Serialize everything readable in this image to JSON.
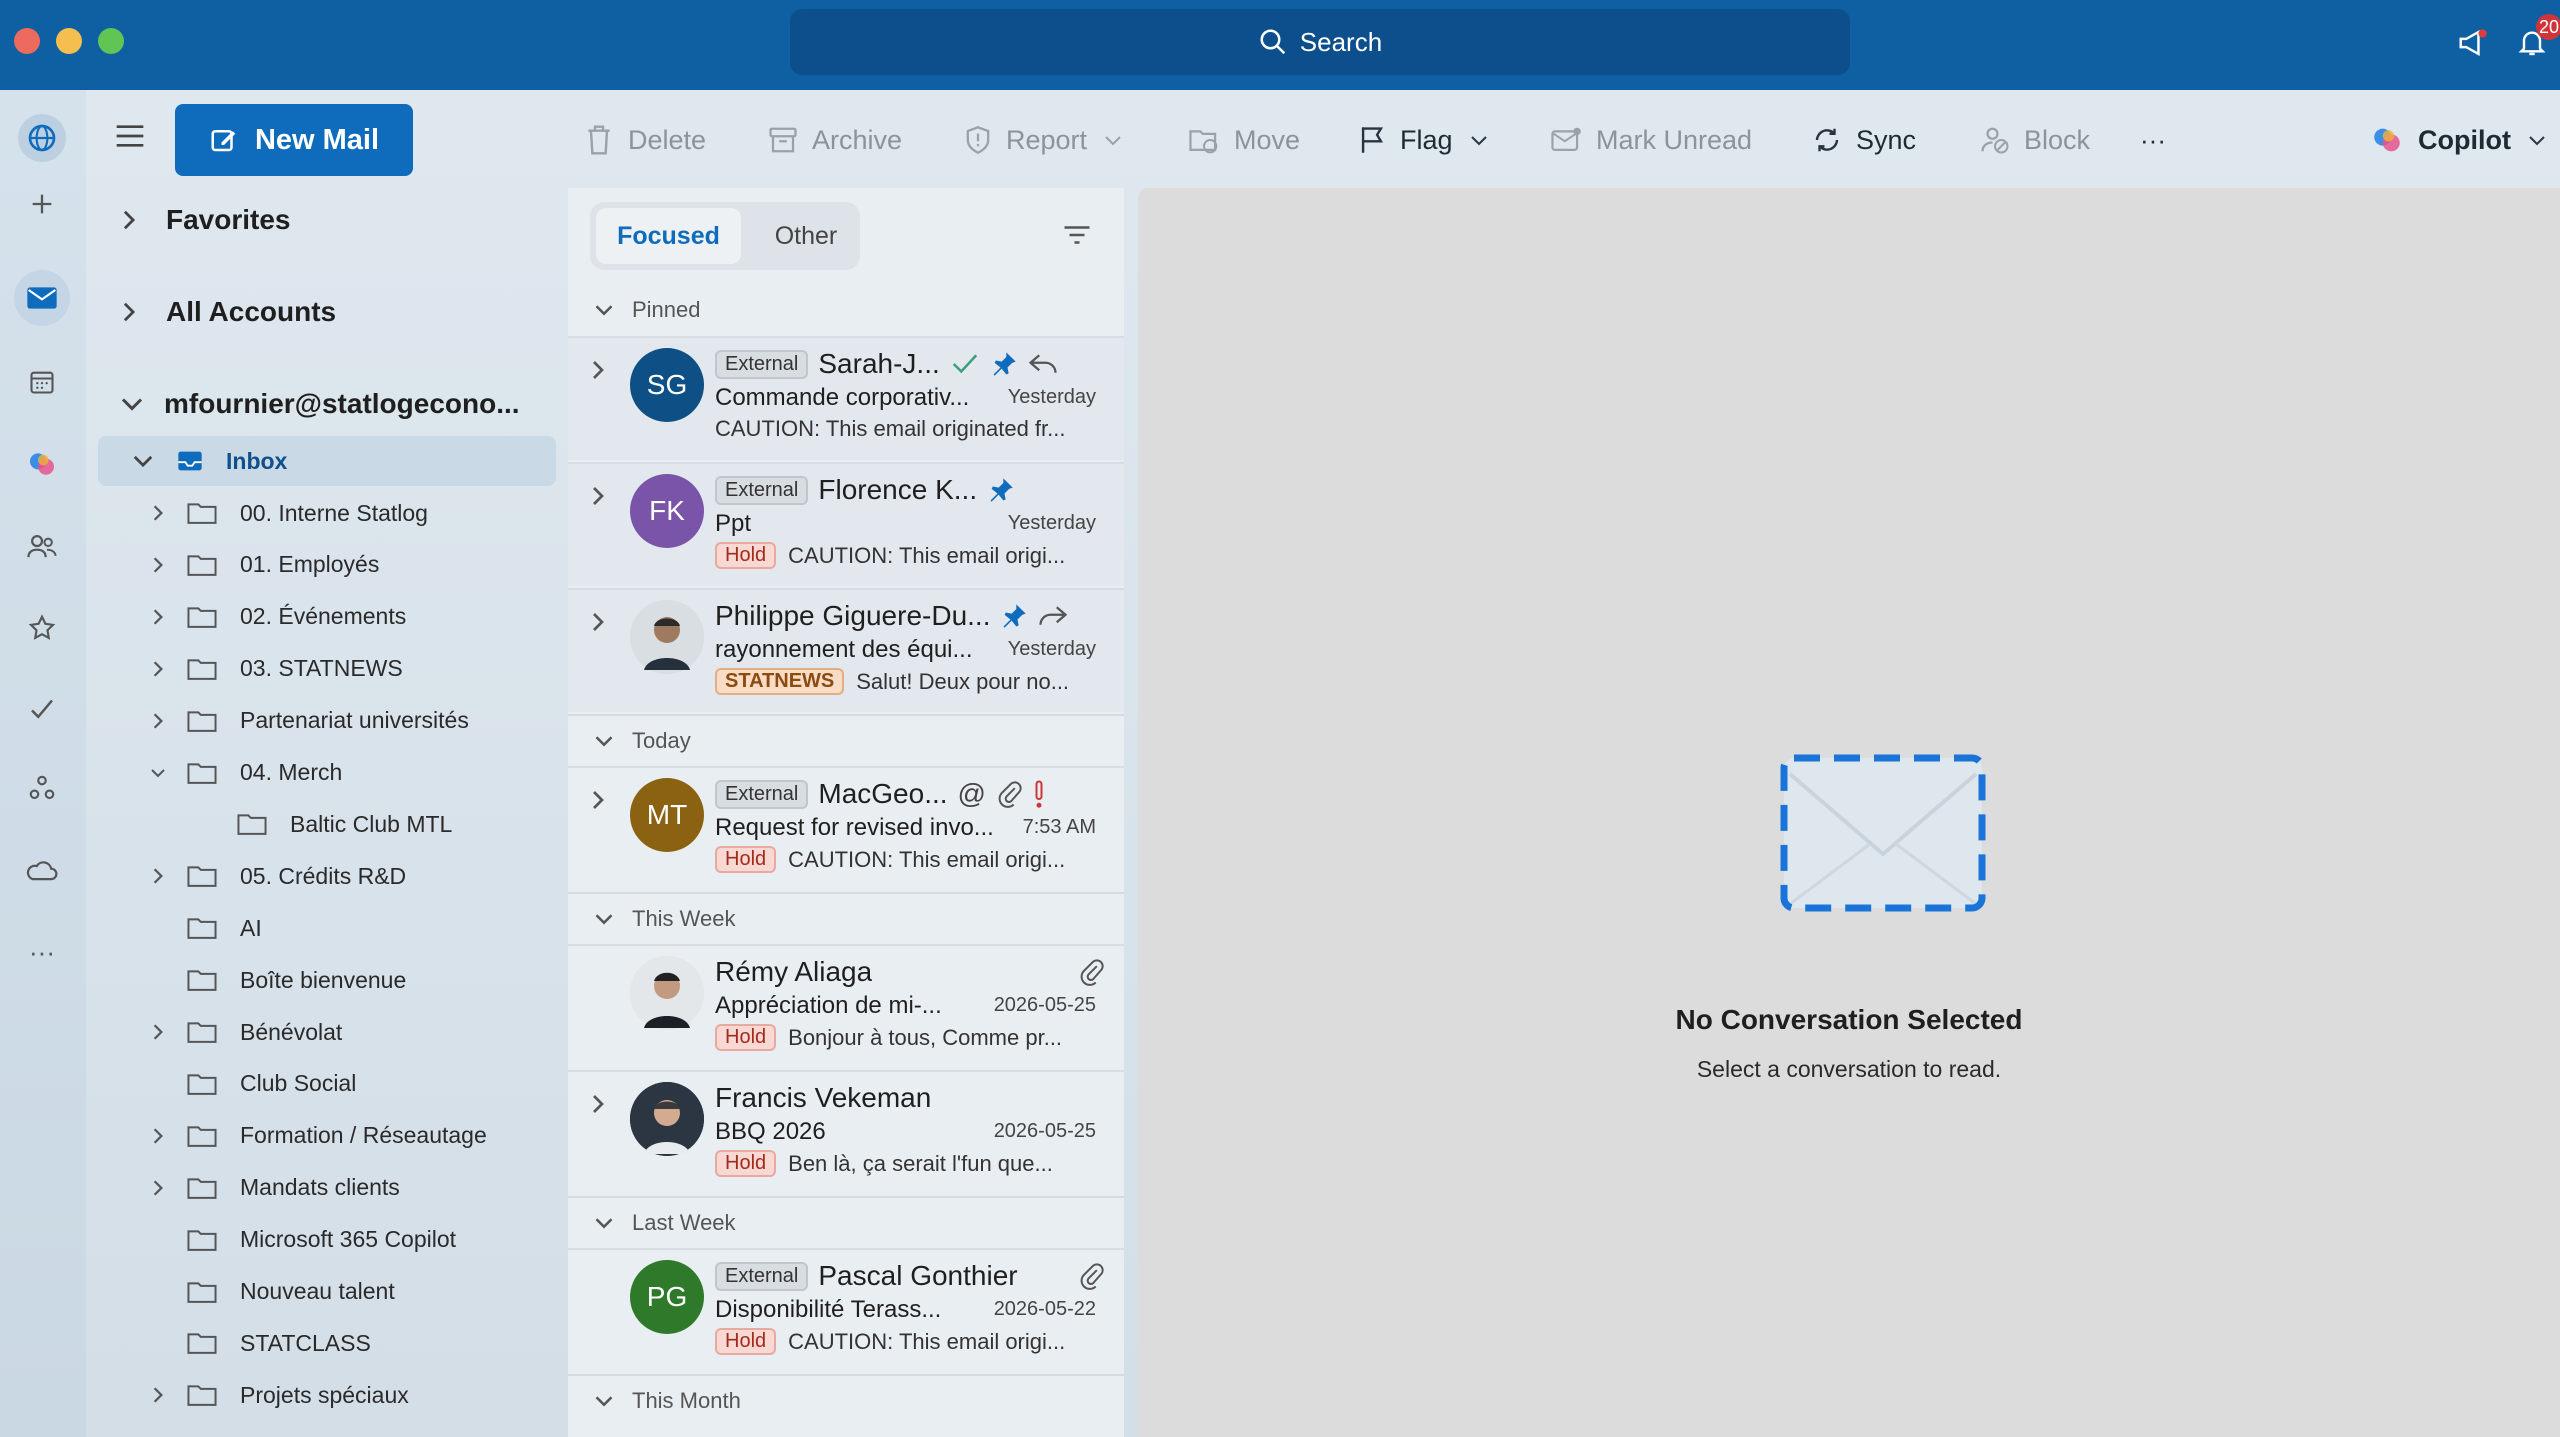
{
  "window": {
    "search_label": "Search",
    "notification_count": "20"
  },
  "toolbar": {
    "new_mail": "New Mail",
    "delete": "Delete",
    "archive": "Archive",
    "report": "Report",
    "move": "Move",
    "flag": "Flag",
    "mark_unread": "Mark Unread",
    "sync": "Sync",
    "block": "Block",
    "more": "···",
    "copilot": "Copilot"
  },
  "nav": {
    "favorites": "Favorites",
    "all_accounts": "All Accounts",
    "account": "mfournier@statlogecono...",
    "inbox": "Inbox",
    "folders": [
      {
        "label": "00. Interne Statlog",
        "expandable": true
      },
      {
        "label": "01. Employés",
        "expandable": true
      },
      {
        "label": "02. Événements",
        "expandable": true
      },
      {
        "label": "03. STATNEWS",
        "expandable": true
      },
      {
        "label": "Partenariat universités",
        "expandable": true
      },
      {
        "label": "04. Merch",
        "expandable": true,
        "expanded": true
      },
      {
        "label": "Baltic Club MTL",
        "expandable": false,
        "child": true
      },
      {
        "label": "05. Crédits R&D",
        "expandable": true
      },
      {
        "label": "AI",
        "expandable": false
      },
      {
        "label": "Boîte bienvenue",
        "expandable": false
      },
      {
        "label": "Bénévolat",
        "expandable": true
      },
      {
        "label": "Club Social",
        "expandable": false
      },
      {
        "label": "Formation / Réseautage",
        "expandable": true
      },
      {
        "label": "Mandats clients",
        "expandable": true
      },
      {
        "label": "Microsoft 365 Copilot",
        "expandable": false
      },
      {
        "label": "Nouveau talent",
        "expandable": false
      },
      {
        "label": "STATCLASS",
        "expandable": false
      },
      {
        "label": "Projets spéciaux",
        "expandable": true
      }
    ]
  },
  "list": {
    "tab_focused": "Focused",
    "tab_other": "Other",
    "sections": {
      "pinned": "Pinned",
      "today": "Today",
      "this_week": "This Week",
      "last_week": "Last Week",
      "this_month": "This Month"
    },
    "external_label": "External",
    "hold_label": "Hold",
    "messages": [
      {
        "initials": "SG",
        "avatar_color": "#0e4f86",
        "sender": "Sarah-J...",
        "subject": "Commande corporativ...",
        "time": "Yesterday",
        "preview": "CAUTION: This email originated fr..."
      },
      {
        "initials": "FK",
        "avatar_color": "#7a54a8",
        "sender": "Florence K...",
        "subject": "Ppt",
        "time": "Yesterday",
        "preview": "CAUTION: This email origi..."
      },
      {
        "initials": "",
        "sender": "Philippe Giguere-Du...",
        "subject": "rayonnement des équi...",
        "time": "Yesterday",
        "tag": "STATNEWS",
        "preview": "Salut! Deux pour no..."
      },
      {
        "initials": "MT",
        "avatar_color": "#8a6212",
        "sender": "MacGeo...",
        "subject": "Request for revised invo...",
        "time": "7:53 AM",
        "preview": "CAUTION: This email origi..."
      },
      {
        "initials": "",
        "sender": "Rémy Aliaga",
        "subject": "Appréciation de mi-...",
        "time": "2026-05-25",
        "preview": "Bonjour à tous, Comme pr..."
      },
      {
        "initials": "",
        "sender": "Francis Vekeman",
        "subject": "BBQ 2026",
        "time": "2026-05-25",
        "preview": "Ben là, ça serait l'fun que..."
      },
      {
        "initials": "PG",
        "avatar_color": "#2f7a2a",
        "sender": "Pascal Gonthier",
        "subject": "Disponibilité Terass...",
        "time": "2026-05-22",
        "preview": "CAUTION: This email origi..."
      }
    ]
  },
  "reading": {
    "title": "No Conversation Selected",
    "subtitle": "Select a conversation to read."
  },
  "colors": {
    "brand": "#0f6cbd",
    "titlebar": "#0f5fa3"
  }
}
